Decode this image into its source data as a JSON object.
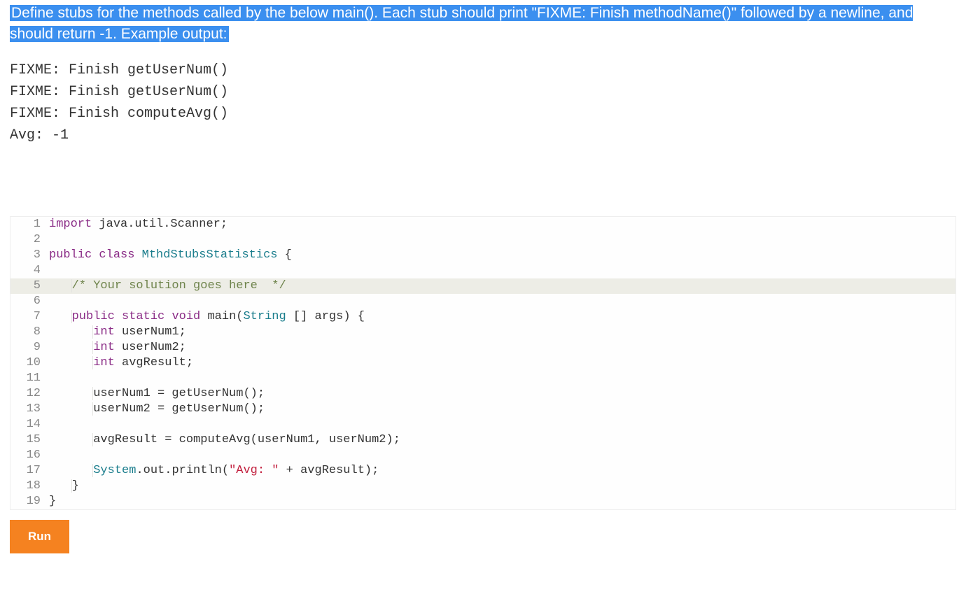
{
  "instruction": "Define stubs for the methods called by the below main(). Each stub should print \"FIXME: Finish methodName()\" followed by a newline, and should return -1. Example output:",
  "example_output": "FIXME: Finish getUserNum()\nFIXME: Finish getUserNum()\nFIXME: Finish computeAvg()\nAvg: -1",
  "run_label": "Run",
  "code": {
    "lines": [
      {
        "n": 1,
        "indent": 0,
        "hl": false,
        "tokens": [
          [
            "kw",
            "import"
          ],
          [
            "id",
            " java.util.Scanner;"
          ]
        ]
      },
      {
        "n": 2,
        "indent": 0,
        "hl": false,
        "tokens": []
      },
      {
        "n": 3,
        "indent": 0,
        "hl": false,
        "tokens": [
          [
            "kw",
            "public"
          ],
          [
            "id",
            " "
          ],
          [
            "kw",
            "class"
          ],
          [
            "id",
            " "
          ],
          [
            "type",
            "MthdStubsStatistics"
          ],
          [
            "id",
            " {"
          ]
        ]
      },
      {
        "n": 4,
        "indent": 0,
        "hl": false,
        "tokens": []
      },
      {
        "n": 5,
        "indent": 1,
        "hl": true,
        "tokens": [
          [
            "comment",
            "/* Your solution goes here  */"
          ]
        ]
      },
      {
        "n": 6,
        "indent": 0,
        "hl": false,
        "tokens": []
      },
      {
        "n": 7,
        "indent": 1,
        "hl": false,
        "tokens": [
          [
            "kw",
            "public"
          ],
          [
            "id",
            " "
          ],
          [
            "kw",
            "static"
          ],
          [
            "id",
            " "
          ],
          [
            "kw",
            "void"
          ],
          [
            "id",
            " main("
          ],
          [
            "type",
            "String"
          ],
          [
            "id",
            " [] args) {"
          ]
        ]
      },
      {
        "n": 8,
        "indent": 2,
        "hl": false,
        "tokens": [
          [
            "kw",
            "int"
          ],
          [
            "id",
            " userNum1;"
          ]
        ]
      },
      {
        "n": 9,
        "indent": 2,
        "hl": false,
        "tokens": [
          [
            "kw",
            "int"
          ],
          [
            "id",
            " userNum2;"
          ]
        ]
      },
      {
        "n": 10,
        "indent": 2,
        "hl": false,
        "tokens": [
          [
            "kw",
            "int"
          ],
          [
            "id",
            " avgResult;"
          ]
        ]
      },
      {
        "n": 11,
        "indent": 0,
        "hl": false,
        "tokens": []
      },
      {
        "n": 12,
        "indent": 2,
        "hl": false,
        "tokens": [
          [
            "id",
            "userNum1 = getUserNum();"
          ]
        ]
      },
      {
        "n": 13,
        "indent": 2,
        "hl": false,
        "tokens": [
          [
            "id",
            "userNum2 = getUserNum();"
          ]
        ]
      },
      {
        "n": 14,
        "indent": 0,
        "hl": false,
        "tokens": []
      },
      {
        "n": 15,
        "indent": 2,
        "hl": false,
        "tokens": [
          [
            "id",
            "avgResult = computeAvg(userNum1, userNum2);"
          ]
        ]
      },
      {
        "n": 16,
        "indent": 0,
        "hl": false,
        "tokens": []
      },
      {
        "n": 17,
        "indent": 2,
        "hl": false,
        "tokens": [
          [
            "type",
            "System"
          ],
          [
            "id",
            ".out.println("
          ],
          [
            "str",
            "\"Avg: \""
          ],
          [
            "id",
            " + avgResult);"
          ]
        ]
      },
      {
        "n": 18,
        "indent": 1,
        "hl": false,
        "tokens": [
          [
            "id",
            "}"
          ]
        ]
      },
      {
        "n": 19,
        "indent": 0,
        "hl": false,
        "tokens": [
          [
            "id",
            "}"
          ]
        ]
      }
    ]
  }
}
